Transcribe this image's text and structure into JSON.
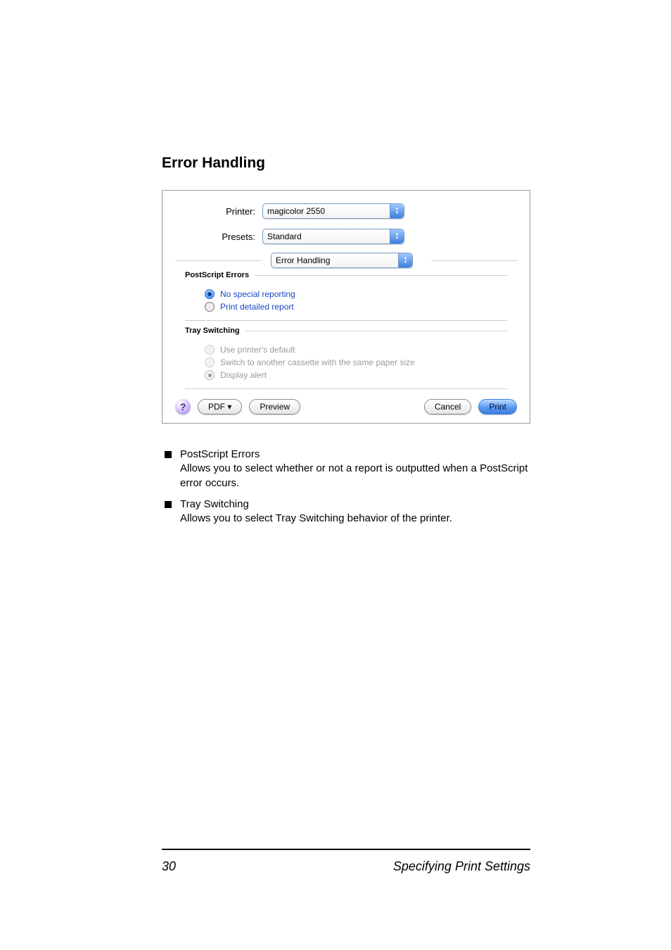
{
  "section_title": "Error Handling",
  "dialog": {
    "printer_label": "Printer:",
    "presets_label": "Presets:",
    "printer_value": "magicolor 2550",
    "presets_value": "Standard",
    "options_select_value": "Error Handling",
    "postscript_group": {
      "title": "PostScript Errors",
      "opt_no_special": "No special reporting",
      "opt_print_report": "Print detailed report"
    },
    "tray_group": {
      "title": "Tray Switching",
      "opt_use_default": "Use printer's default",
      "opt_switch_cassette": "Switch to another cassette with the same paper size",
      "opt_display_alert": "Display alert"
    },
    "help_icon": "?",
    "pdf_label": "PDF ▾",
    "preview_label": "Preview",
    "cancel_label": "Cancel",
    "print_label": "Print"
  },
  "bullets": {
    "ps_title": "PostScript Errors",
    "ps_body": "Allows you to select whether or not a report is outputted when a Post­Script error occurs.",
    "tray_title": "Tray Switching",
    "tray_body": "Allows you to select Tray Switching behavior of the printer."
  },
  "footer": {
    "page_number": "30",
    "label": "Specifying Print Settings"
  }
}
